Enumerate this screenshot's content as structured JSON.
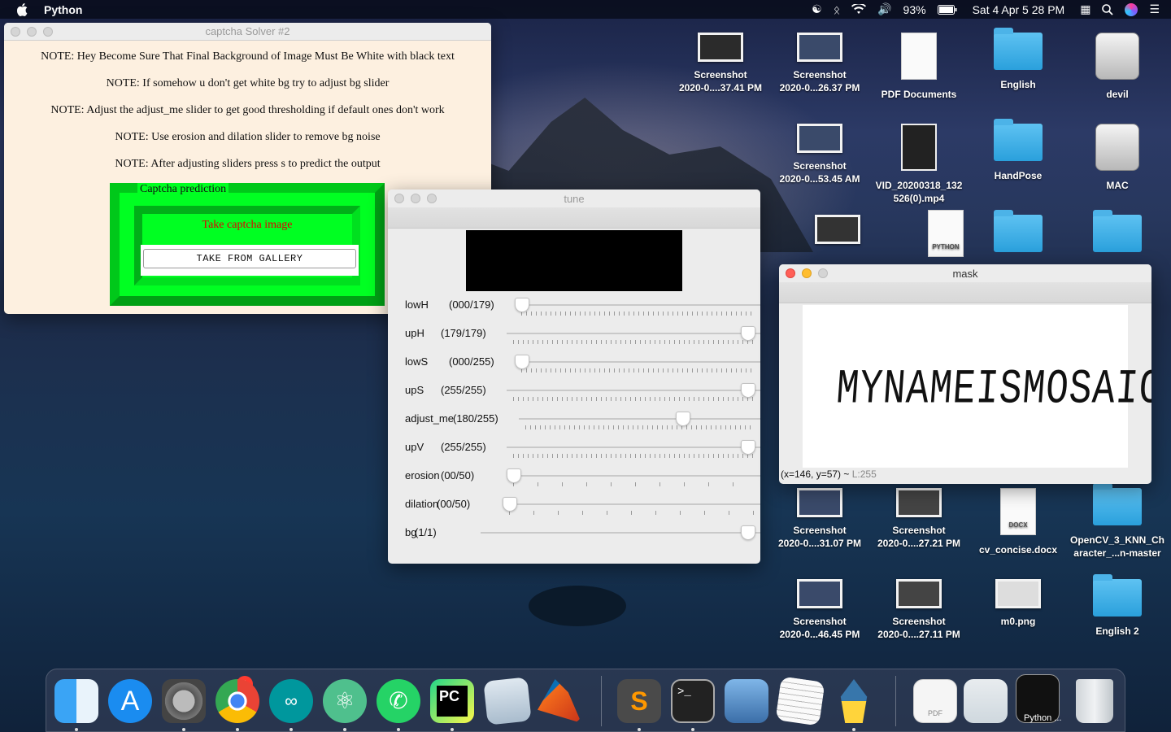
{
  "menubar": {
    "app_name": "Python",
    "battery": "93%",
    "datetime": "Sat 4 Apr  5 28 PM"
  },
  "solver": {
    "title": "captcha Solver #2",
    "notes": [
      "NOTE: Hey Become Sure That Final Background of Image Must Be White with black text",
      "NOTE: If somehow u don't get white bg try to adjust bg slider",
      "NOTE: Adjust the adjust_me slider to get good thresholding if default ones don't work",
      "NOTE: Use erosion and dilation slider to remove bg noise",
      "NOTE: After adjusting sliders press s to predict the output"
    ],
    "frame_label": "Captcha prediction",
    "take_text": "Take captcha image",
    "gallery_button": "TAKE FROM GALLERY"
  },
  "tune": {
    "title": "tune",
    "sliders": [
      {
        "label": "lowH",
        "display": "(000/179)",
        "value": 0,
        "max": 179
      },
      {
        "label": "upH",
        "display": "(179/179)",
        "value": 179,
        "max": 179
      },
      {
        "label": "lowS",
        "display": "(000/255)",
        "value": 0,
        "max": 255
      },
      {
        "label": "upS",
        "display": "(255/255)",
        "value": 255,
        "max": 255
      },
      {
        "label": "adjust_me",
        "display": "(180/255)",
        "value": 180,
        "max": 255
      },
      {
        "label": "upV",
        "display": "(255/255)",
        "value": 255,
        "max": 255
      },
      {
        "label": "erosion",
        "display": "(00/50)",
        "value": 0,
        "max": 50
      },
      {
        "label": "dilation",
        "display": "(00/50)",
        "value": 0,
        "max": 50
      },
      {
        "label": "bg",
        "display": "(1/1)",
        "value": 1,
        "max": 1
      }
    ]
  },
  "mask": {
    "title": "mask",
    "image_text": "MYNAMEISMOSAIC",
    "coords": "(x=146, y=57) ~ ",
    "level": "L:255"
  },
  "desktop": [
    {
      "name": "Screenshot",
      "sub": "2020-0....37.41 PM",
      "kind": "thumb"
    },
    {
      "name": "Screenshot",
      "sub": "2020-0...26.37 PM",
      "kind": "thumb"
    },
    {
      "name": "PDF Documents",
      "sub": "",
      "kind": "doc"
    },
    {
      "name": "English",
      "sub": "",
      "kind": "folder"
    },
    {
      "name": "devil",
      "sub": "",
      "kind": "disk"
    },
    {
      "name": "Screenshot",
      "sub": "2020-0...53.45 AM",
      "kind": "thumb"
    },
    {
      "name": "VID_20200318_132",
      "sub": "526(0).mp4",
      "kind": "vid"
    },
    {
      "name": "HandPose",
      "sub": "",
      "kind": "folder"
    },
    {
      "name": "MAC",
      "sub": "",
      "kind": "disk"
    },
    {
      "name": "Screenshot",
      "sub": "2020-0....31.07 PM",
      "kind": "thumb"
    },
    {
      "name": "Screenshot",
      "sub": "2020-0....27.21 PM",
      "kind": "thumb"
    },
    {
      "name": "cv_concise.docx",
      "sub": "",
      "kind": "doc"
    },
    {
      "name": "OpenCV_3_KNN_Ch",
      "sub": "aracter_...n-master",
      "kind": "folder"
    },
    {
      "name": "Screenshot",
      "sub": "2020-0...46.45 PM",
      "kind": "thumb"
    },
    {
      "name": "Screenshot",
      "sub": "2020-0....27.11 PM",
      "kind": "thumb"
    },
    {
      "name": "m0.png",
      "sub": "",
      "kind": "thumb"
    },
    {
      "name": "English 2",
      "sub": "",
      "kind": "folder"
    }
  ],
  "dock": {
    "badge": "1",
    "python_label": "Python ...",
    "docx_tag": "DOCX",
    "pdf_tag": "PDF",
    "python_tag": "PYTHON"
  }
}
